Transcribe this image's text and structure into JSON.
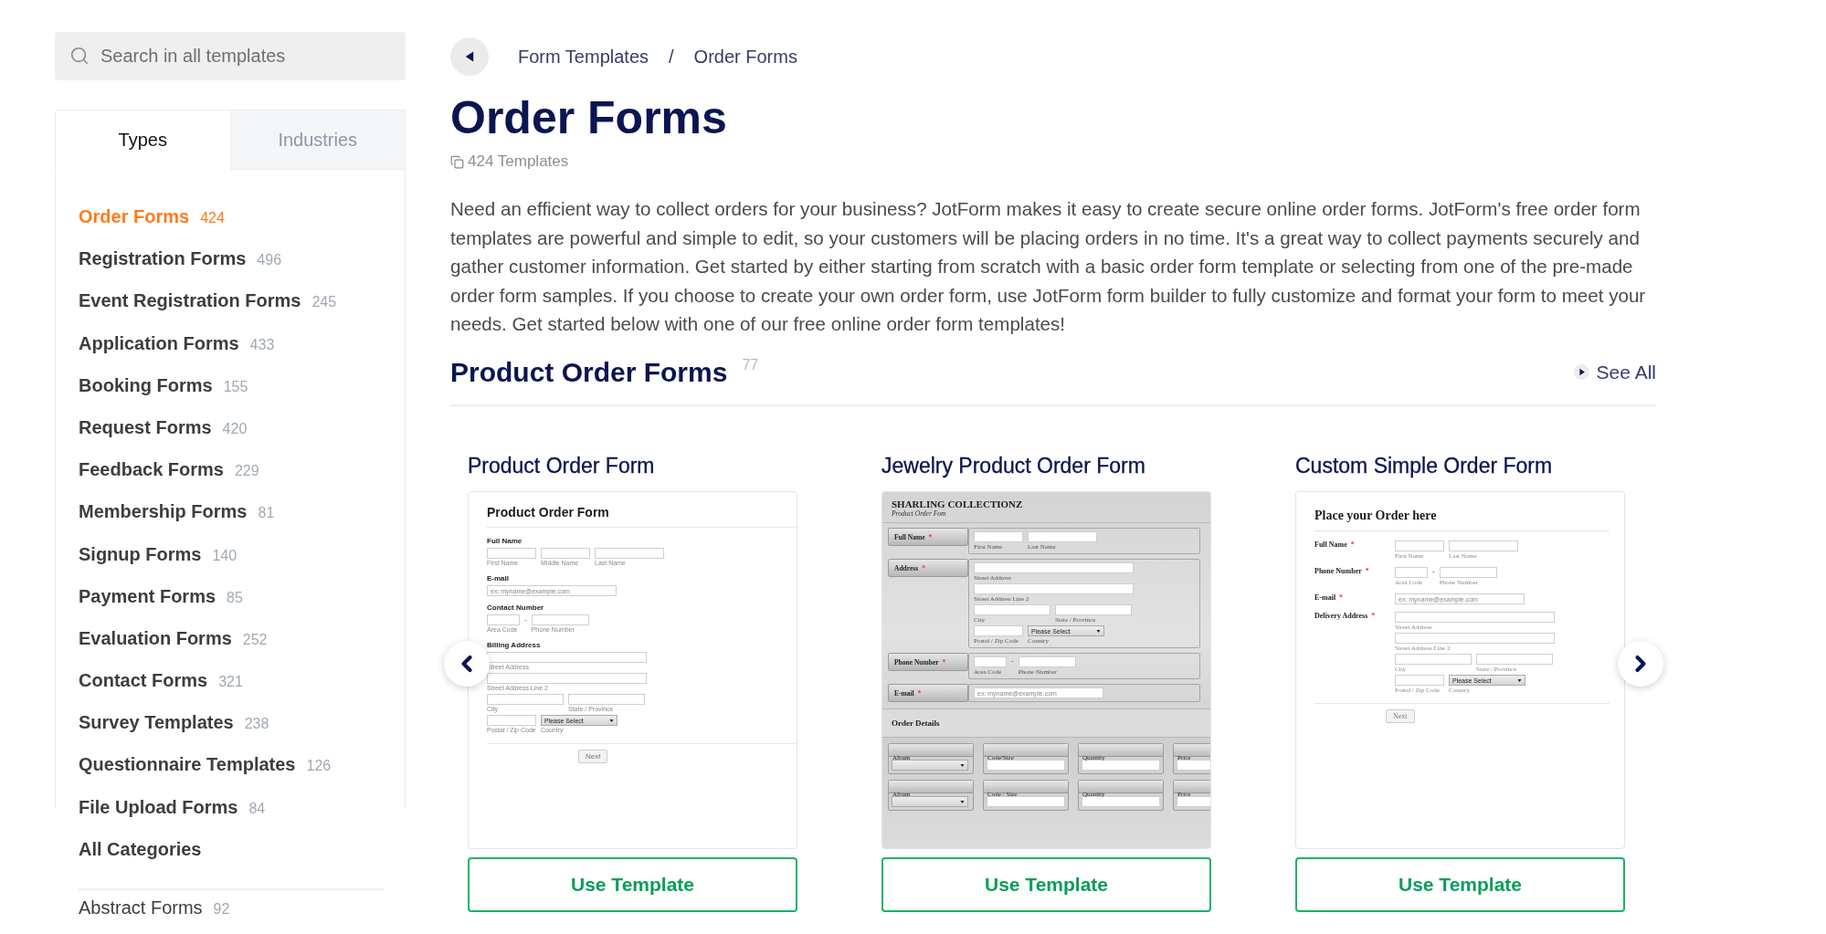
{
  "search": {
    "placeholder": "Search in all templates"
  },
  "tabs": [
    {
      "label": "Types",
      "selected": true
    },
    {
      "label": "Industries",
      "selected": false
    }
  ],
  "categories": [
    {
      "name": "Order Forms",
      "count": "424",
      "selected": true
    },
    {
      "name": "Registration Forms",
      "count": "496",
      "selected": false
    },
    {
      "name": "Event Registration Forms",
      "count": "245",
      "selected": false
    },
    {
      "name": "Application Forms",
      "count": "433",
      "selected": false
    },
    {
      "name": "Booking Forms",
      "count": "155",
      "selected": false
    },
    {
      "name": "Request Forms",
      "count": "420",
      "selected": false
    },
    {
      "name": "Feedback Forms",
      "count": "229",
      "selected": false
    },
    {
      "name": "Membership Forms",
      "count": "81",
      "selected": false
    },
    {
      "name": "Signup Forms",
      "count": "140",
      "selected": false
    },
    {
      "name": "Payment Forms",
      "count": "85",
      "selected": false
    },
    {
      "name": "Evaluation Forms",
      "count": "252",
      "selected": false
    },
    {
      "name": "Contact Forms",
      "count": "321",
      "selected": false
    },
    {
      "name": "Survey Templates",
      "count": "238",
      "selected": false
    },
    {
      "name": "Questionnaire Templates",
      "count": "126",
      "selected": false
    },
    {
      "name": "File Upload Forms",
      "count": "84",
      "selected": false
    },
    {
      "name": "All Categories",
      "selected": false
    }
  ],
  "more_categories": [
    {
      "name": "Abstract Forms",
      "count": "92"
    }
  ],
  "breadcrumb": [
    {
      "label": "Form Templates",
      "kind": "link"
    },
    {
      "label": "/",
      "kind": "separator"
    },
    {
      "label": "Order Forms",
      "kind": "current"
    }
  ],
  "title": "Order Forms",
  "template_count": "424 Templates",
  "description": "Need an efficient way to collect orders for your business? JotForm makes it easy to create secure online order forms. JotForm's free order form templates are powerful and simple to edit, so your customers will be placing orders in no time. It's a great way to collect payments securely and gather customer information. Get started by either starting from scratch with a basic order form template or selecting from one of the pre-made order form samples. If you choose to create your own order form, use JotForm form builder to fully customize and format your form to meet your needs. Get started below with one of our free online order form templates!",
  "section": {
    "title": "Product Order Forms",
    "count": "77",
    "see_all": "See All"
  },
  "cards": [
    {
      "title": "Product Order Form",
      "button": "Use Template",
      "preview": {
        "kind": "plain",
        "title": "Product Order Form",
        "fields": [
          {
            "label": "Full Name",
            "rows": [
              [
                {
                  "kind": "short",
                  "sublabel": "First Name"
                },
                {
                  "kind": "short",
                  "sublabel": "Middle Name"
                },
                {
                  "kind": "wide",
                  "sublabel": "Last Name"
                }
              ]
            ]
          },
          {
            "label": "E-mail",
            "rows": [
              [
                {
                  "kind": "email",
                  "placeholder": "ex: myname@example.com"
                }
              ]
            ]
          },
          {
            "label": "Contact Number",
            "rows": [
              [
                {
                  "kind": "tiny",
                  "sublabel": "Area Code"
                },
                {
                  "kind": "dash",
                  "text": "-"
                },
                {
                  "kind": "medium",
                  "sublabel": "Phone Number"
                }
              ]
            ]
          },
          {
            "label": "Billing Address",
            "rows": [
              [
                {
                  "kind": "street",
                  "sublabel": "Street Address"
                }
              ],
              [
                {
                  "kind": "street",
                  "sublabel": "Street Address Line 2"
                }
              ],
              [
                {
                  "kind": "long",
                  "sublabel": "City"
                },
                {
                  "kind": "long",
                  "sublabel": "State / Province"
                }
              ],
              [
                {
                  "kind": "short",
                  "sublabel": "Postal / Zip Code"
                },
                {
                  "kind": "select",
                  "value": "Please Select",
                  "sublabel": "Country"
                }
              ]
            ]
          }
        ],
        "button": "Next"
      }
    },
    {
      "title": "Jewelry Product Order Form",
      "button": "Use Template",
      "preview": {
        "kind": "metal",
        "title": "SHARLING COLLECTIONZ",
        "subtitle": "Product Order Fom",
        "fields": [
          {
            "label": "Full Name",
            "asterisk": "*",
            "rows": [
              [
                {
                  "kind": "short",
                  "sublabel": "First Name"
                },
                {
                  "kind": "wide",
                  "sublabel": "Last Name"
                }
              ]
            ]
          },
          {
            "label": "Address",
            "asterisk": "*",
            "rows": [
              [
                {
                  "kind": "street",
                  "sublabel": "Street Address"
                }
              ],
              [
                {
                  "kind": "street",
                  "sublabel": "Street Address Line 2"
                }
              ],
              [
                {
                  "kind": "long",
                  "sublabel": "City"
                },
                {
                  "kind": "long",
                  "sublabel": "State / Province"
                }
              ],
              [
                {
                  "kind": "short",
                  "sublabel": "Postal / Zip Code"
                },
                {
                  "kind": "select",
                  "value": "Please Select",
                  "sublabel": "Country"
                }
              ]
            ]
          },
          {
            "label": "Phone Number",
            "asterisk": "*",
            "rows": [
              [
                {
                  "kind": "tiny",
                  "sublabel": "Area Code"
                },
                {
                  "kind": "dash",
                  "text": "-"
                },
                {
                  "kind": "medium",
                  "sublabel": "Phone Number"
                }
              ]
            ]
          },
          {
            "label": "E-mail",
            "asterisk": "*",
            "rows": [
              [
                {
                  "kind": "email",
                  "placeholder": "ex: myname@example.com"
                }
              ]
            ]
          }
        ],
        "order_details": {
          "title": "Order Details",
          "rows": [
            [
              {
                "label": "Album",
                "kind": "select"
              },
              {
                "label": "Code/Size",
                "kind": "text"
              },
              {
                "label": "Quantity",
                "kind": "text"
              },
              {
                "label": "Price",
                "kind": "text"
              }
            ],
            [
              {
                "label": "Album",
                "kind": "select"
              },
              {
                "label": "Code / Size",
                "kind": "text"
              },
              {
                "label": "Quantity",
                "kind": "text"
              },
              {
                "label": "Price",
                "kind": "text"
              }
            ]
          ]
        }
      }
    },
    {
      "title": "Custom Simple Order Form",
      "button": "Use Template",
      "preview": {
        "kind": "classic",
        "title": "Place your Order here",
        "fields": [
          {
            "label": "Full Name",
            "asterisk": "*",
            "rows": [
              [
                {
                  "kind": "short",
                  "sublabel": "First Name"
                },
                {
                  "kind": "wide",
                  "sublabel": "Last Name"
                }
              ]
            ]
          },
          {
            "label": "Phone Number",
            "asterisk": "*",
            "rows": [
              [
                {
                  "kind": "tiny",
                  "sublabel": "Area Code"
                },
                {
                  "kind": "dash",
                  "text": "-"
                },
                {
                  "kind": "medium",
                  "sublabel": "Phone Number"
                }
              ]
            ]
          },
          {
            "label": "E-mail",
            "asterisk": "*",
            "rows": [
              [
                {
                  "kind": "email",
                  "placeholder": "ex: myname@example.com"
                }
              ]
            ]
          },
          {
            "label": "Delivery Address",
            "asterisk": "*",
            "rows": [
              [
                {
                  "kind": "street",
                  "sublabel": "Street Address"
                }
              ],
              [
                {
                  "kind": "street",
                  "sublabel": "Street Address Line 2"
                }
              ],
              [
                {
                  "kind": "long",
                  "sublabel": "City"
                },
                {
                  "kind": "long",
                  "sublabel": "State / Province"
                }
              ],
              [
                {
                  "kind": "short",
                  "sublabel": "Postal / Zip Code"
                },
                {
                  "kind": "select",
                  "value": "Please Select",
                  "sublabel": "Country"
                }
              ]
            ]
          }
        ],
        "button": "Next"
      }
    }
  ]
}
